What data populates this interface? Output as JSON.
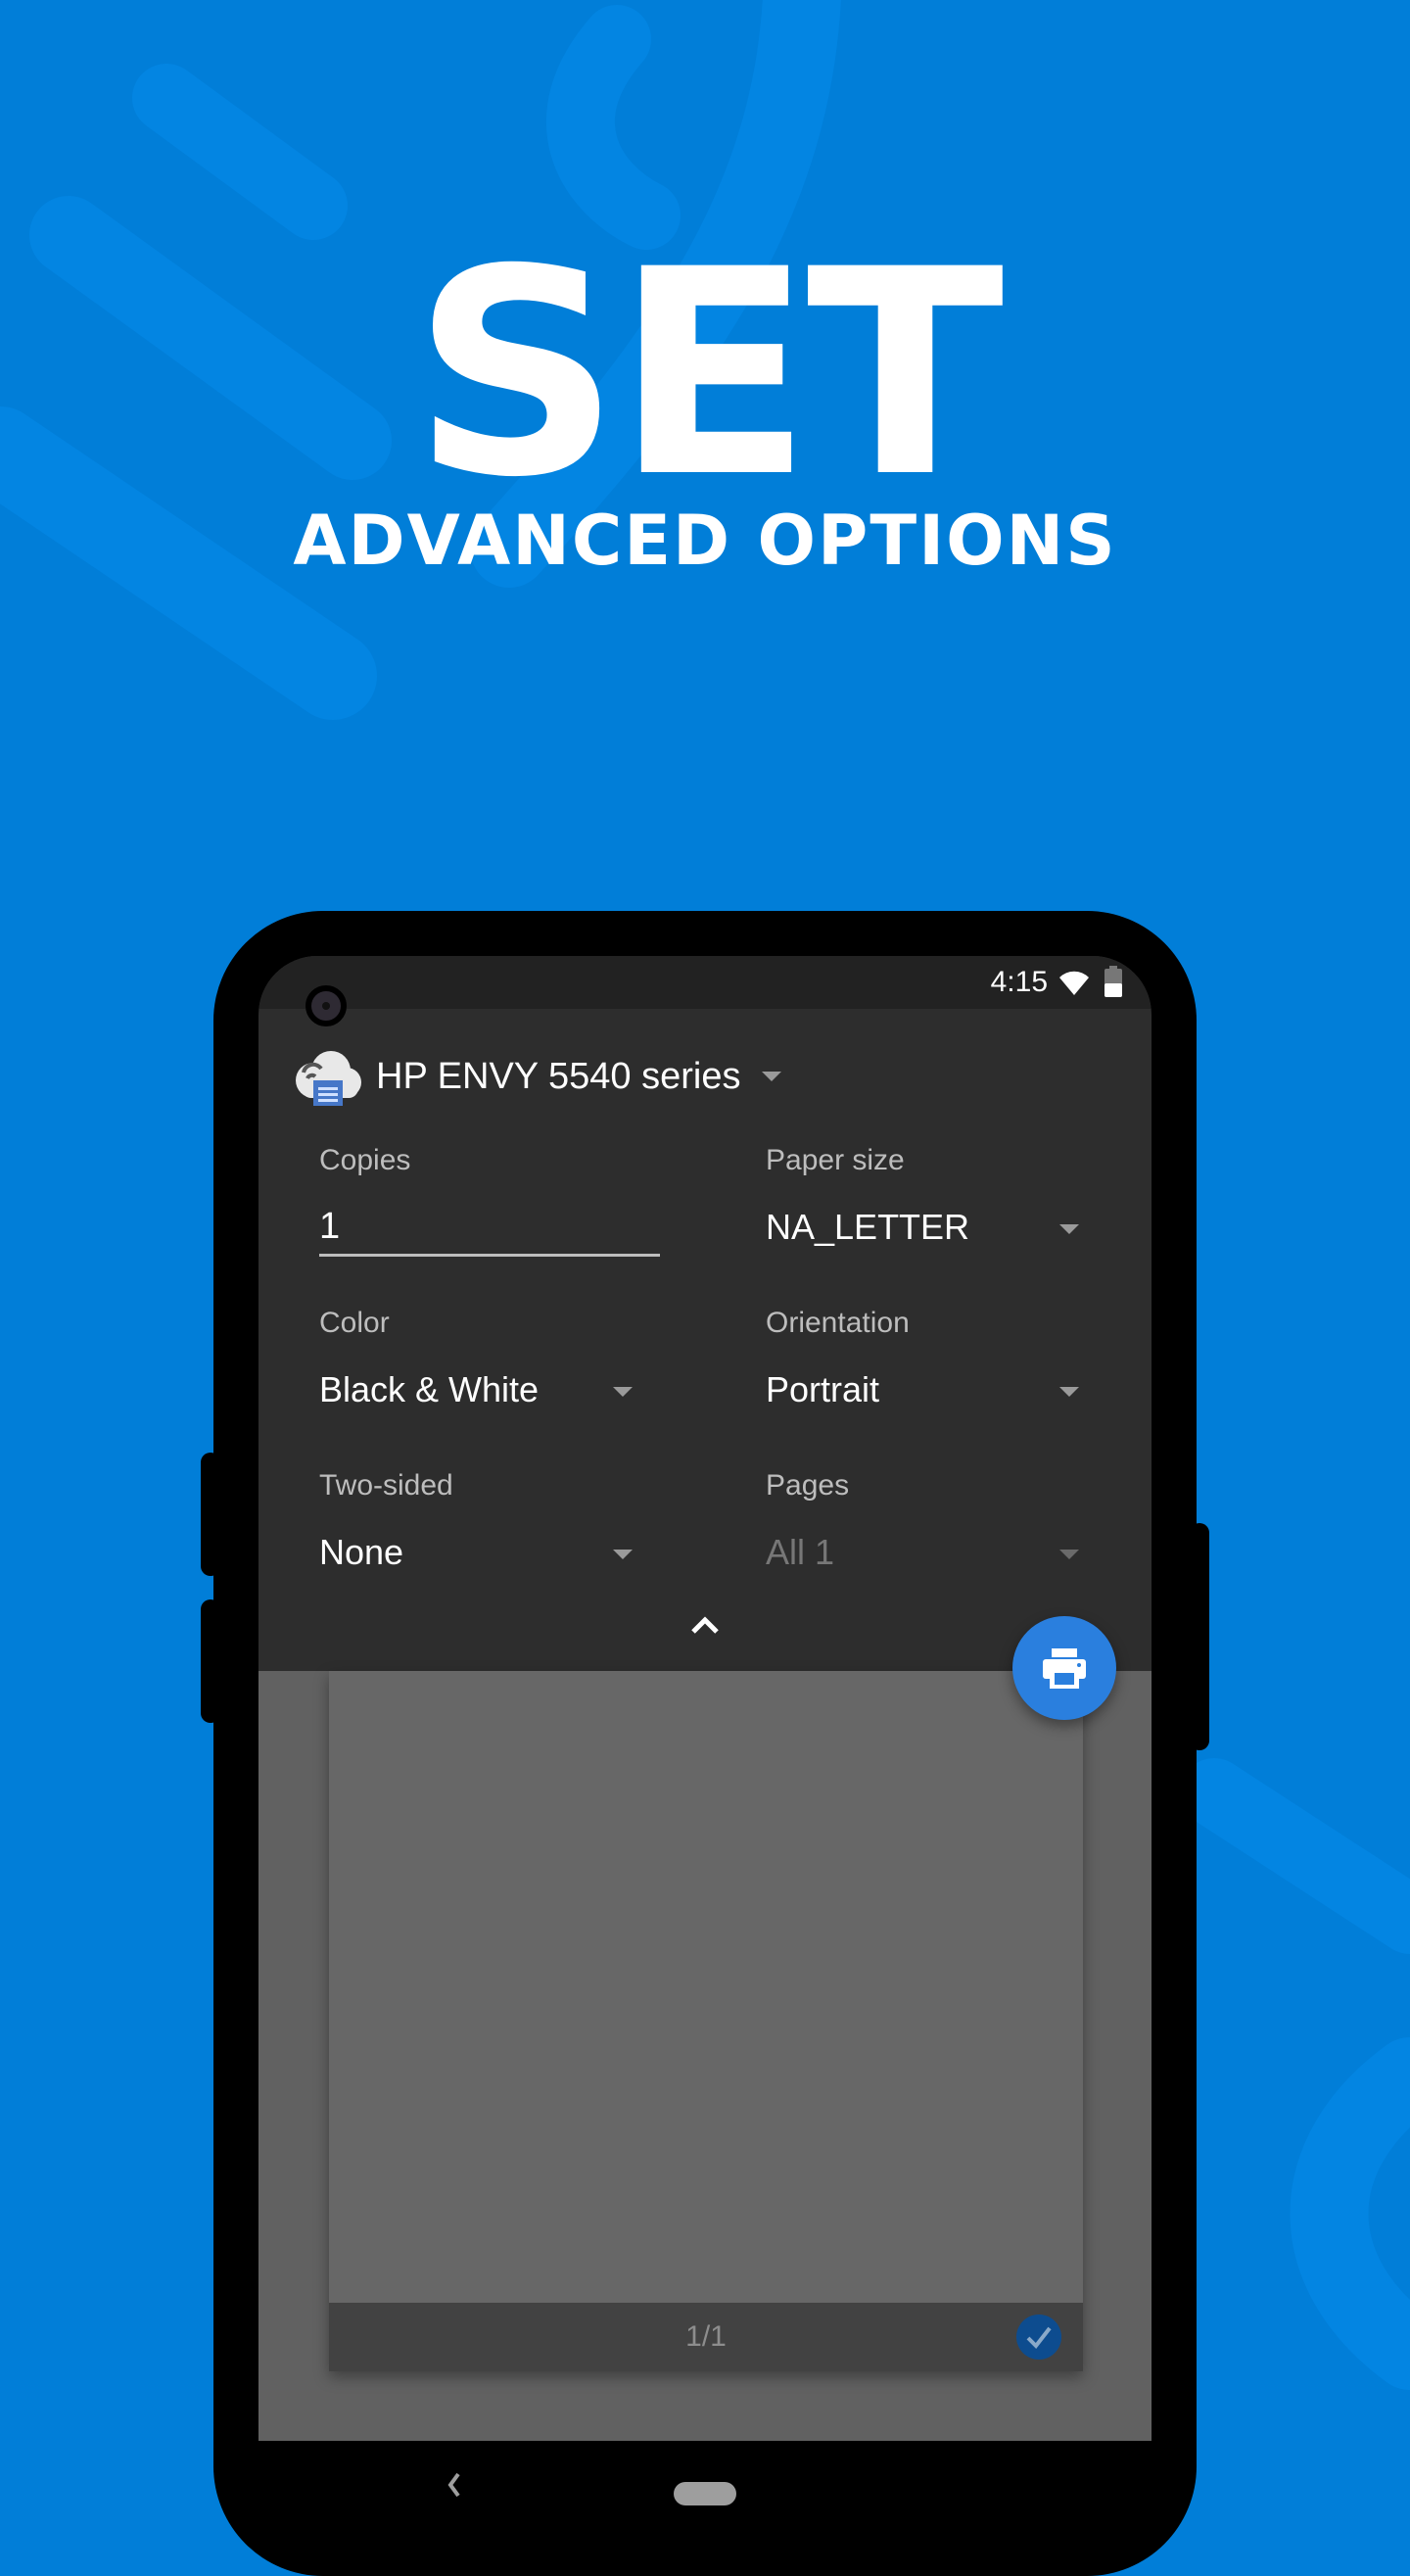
{
  "promo": {
    "headline": "SET",
    "subheadline": "ADVANCED OPTIONS",
    "background_color": "#017ed8"
  },
  "status_bar": {
    "time": "4:15",
    "icons": [
      "wifi-icon",
      "battery-icon"
    ]
  },
  "print_dialog": {
    "printer_name": "HP ENVY 5540 series",
    "printer_icon": "cloud-print-icon",
    "fields": {
      "copies": {
        "label": "Copies",
        "value": "1"
      },
      "paper_size": {
        "label": "Paper size",
        "value": "NA_LETTER"
      },
      "color": {
        "label": "Color",
        "value": "Black & White"
      },
      "orientation": {
        "label": "Orientation",
        "value": "Portrait"
      },
      "two_sided": {
        "label": "Two-sided",
        "value": "None"
      },
      "pages": {
        "label": "Pages",
        "value": "All 1",
        "disabled": true
      }
    },
    "collapse_icon": "chevron-up-icon",
    "print_button_icon": "printer-icon",
    "accent_color": "#2a7fde"
  },
  "preview": {
    "page_indicator": "1/1",
    "page_selected": true
  },
  "nav_bar": {
    "back_icon": "back-chevron-icon",
    "home_icon": "home-pill-icon"
  }
}
